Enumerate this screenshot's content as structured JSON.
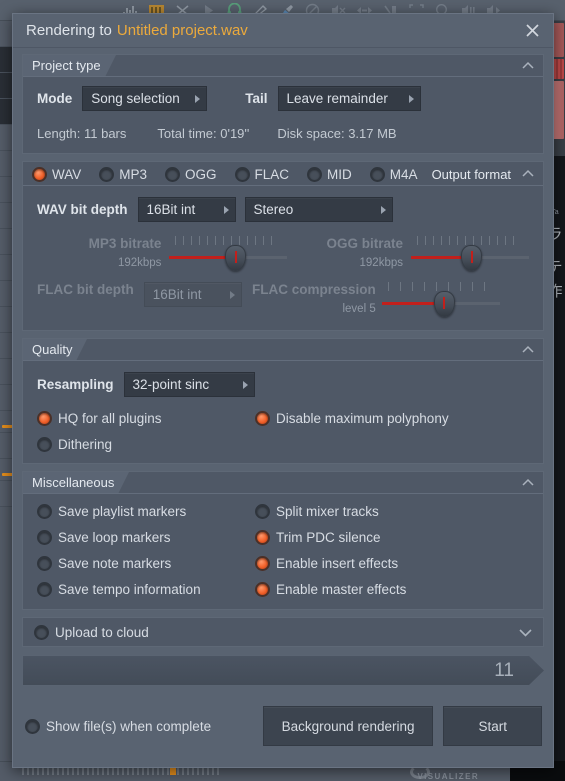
{
  "background": {
    "toolbar_icons": [
      "bar-chart-icon",
      "pattern-blocks-icon",
      "close-x-icon",
      "play-icon",
      "headphones-icon",
      "pencil-icon",
      "paint-brush-icon",
      "mute-circle-icon",
      "speaker-mute-icon",
      "arrows-horizontal-icon",
      "magnet-icon",
      "crop-brackets-icon",
      "magnifier-icon",
      "speaker-bars-icon",
      "speaker-right-icon"
    ],
    "visualizer_label": "VISUALIZER",
    "playlist_text_1": "Ta",
    "playlist_text_2": "ラ",
    "playlist_text_3": "テ",
    "playlist_text_4": "作"
  },
  "titlebar": {
    "prefix": "Rendering to",
    "filename": "Untitled project.wav",
    "close_icon": "close-x-icon",
    "accent_color": "#ecaa3c"
  },
  "project_type": {
    "title": "Project type",
    "mode_label": "Mode",
    "mode_value": "Song selection",
    "tail_label": "Tail",
    "tail_value": "Leave remainder",
    "length": "Length: 11 bars",
    "total_time": "Total time: 0'19''",
    "disk_space": "Disk space: 3.17 MB"
  },
  "output_format": {
    "title": "Output format",
    "formats": [
      {
        "label": "WAV",
        "selected": true
      },
      {
        "label": "MP3",
        "selected": false
      },
      {
        "label": "OGG",
        "selected": false
      },
      {
        "label": "FLAC",
        "selected": false
      },
      {
        "label": "MID",
        "selected": false
      },
      {
        "label": "M4A",
        "selected": false
      }
    ],
    "wav_bit_depth_label": "WAV bit depth",
    "wav_bit_depth_value": "16Bit int",
    "channel_value": "Stereo",
    "mp3_bitrate_label": "MP3 bitrate",
    "mp3_bitrate_value": "192kbps",
    "ogg_bitrate_label": "OGG bitrate",
    "ogg_bitrate_value": "192kbps",
    "flac_bit_depth_label": "FLAC bit depth",
    "flac_bit_depth_value": "16Bit int",
    "flac_compression_label": "FLAC compression",
    "flac_compression_value": "level 5"
  },
  "quality": {
    "title": "Quality",
    "resampling_label": "Resampling",
    "resampling_value": "32-point sinc",
    "options": [
      {
        "label": "HQ for all plugins",
        "on": true
      },
      {
        "label": "Disable maximum polyphony",
        "on": true
      },
      {
        "label": "Dithering",
        "on": false
      }
    ]
  },
  "miscellaneous": {
    "title": "Miscellaneous",
    "left_options": [
      {
        "label": "Save playlist markers",
        "on": false
      },
      {
        "label": "Save loop markers",
        "on": false
      },
      {
        "label": "Save note markers",
        "on": false
      },
      {
        "label": "Save tempo information",
        "on": false
      }
    ],
    "right_options": [
      {
        "label": "Split mixer tracks",
        "on": false
      },
      {
        "label": "Trim PDC silence",
        "on": true
      },
      {
        "label": "Enable insert effects",
        "on": true
      },
      {
        "label": "Enable master effects",
        "on": true
      }
    ]
  },
  "upload": {
    "label": "Upload to cloud",
    "on": false,
    "chevron_icon": "chevron-down-icon"
  },
  "progress": {
    "value": "11"
  },
  "footer": {
    "show_files_label": "Show file(s) when complete",
    "show_files_on": false,
    "background_rendering_label": "Background rendering",
    "start_label": "Start"
  }
}
